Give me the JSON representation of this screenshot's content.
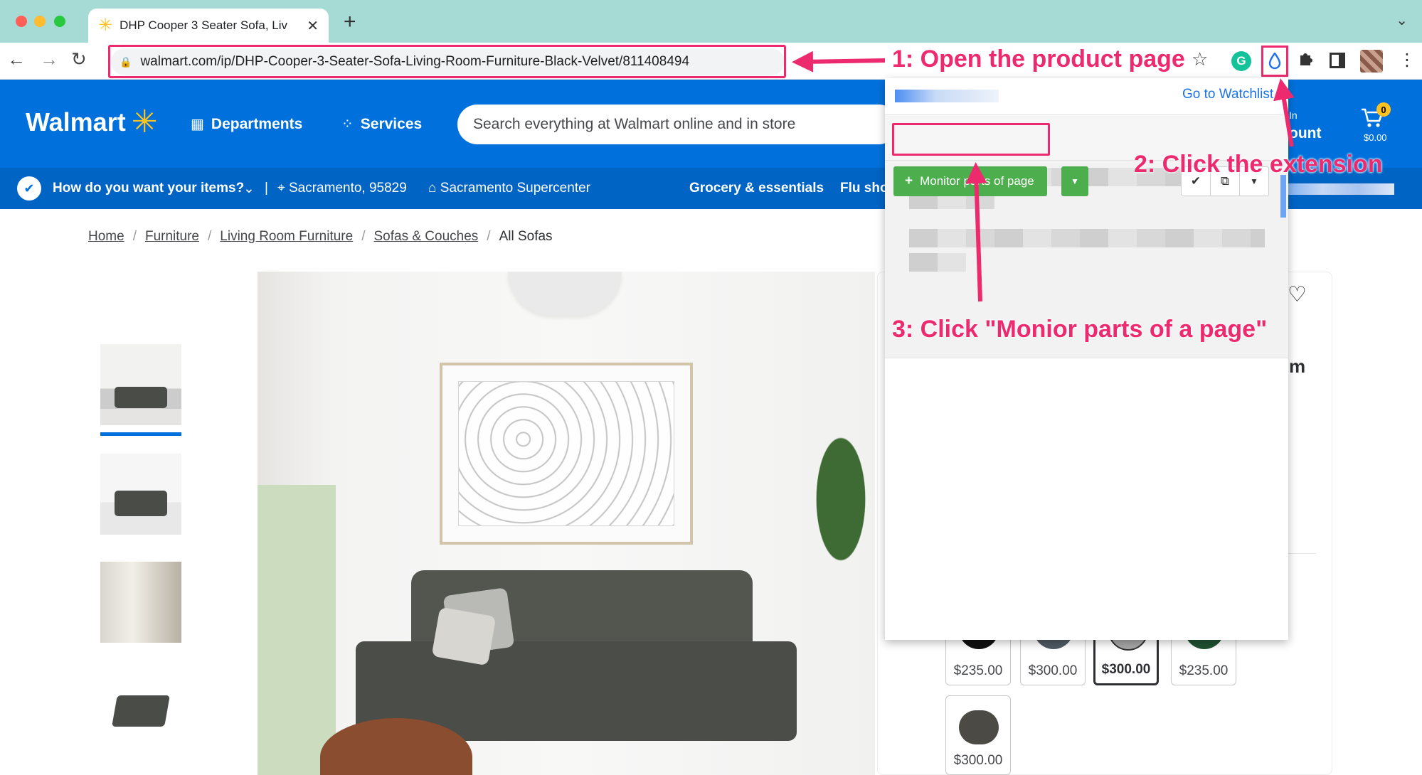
{
  "browser": {
    "tab": {
      "title": "DHP Cooper 3 Seater Sofa, Liv",
      "favicon": "walmart-spark-icon",
      "close": "✕"
    },
    "new_tab": "+",
    "url": "walmart.com/ip/DHP-Cooper-3-Seater-Sofa-Living-Room-Furniture-Black-Velvet/811408494",
    "nav": {
      "back": "←",
      "forward": "→",
      "reload": "↻"
    },
    "star": "☆",
    "grammarly": "G",
    "extension_icon": "💧",
    "puzzle": "✚",
    "kebab": "⋮"
  },
  "walmart": {
    "logo_text": "Walmart",
    "spark": "✳",
    "departments": "Departments",
    "services": "Services",
    "search_placeholder": "Search everything at Walmart online and in store",
    "account_partial": "ount",
    "signin_partial": "In",
    "cart_count": "0",
    "cart_total": "$0.00",
    "subbar": {
      "how": "How do you want your items?",
      "chevron": "⌄",
      "separator": "|",
      "location": "Sacramento, 95829",
      "store": "Sacramento Supercenter",
      "grocery": "Grocery & essentials",
      "flu": "Flu sho"
    }
  },
  "breadcrumb": {
    "items": [
      "Home",
      "Furniture",
      "Living Room Furniture",
      "Sofas & Couches"
    ],
    "current": "All Sofas",
    "separator": "/"
  },
  "product": {
    "heart": "♡",
    "partial_letter": "m",
    "swatches": [
      {
        "price": "$235.00",
        "color": "#111111",
        "selected": false
      },
      {
        "price": "$300.00",
        "color": "#505a63",
        "selected": false
      },
      {
        "price": "$300.00",
        "color": "#a8a8a8",
        "selected": true
      },
      {
        "price": "$235.00",
        "color": "#1f5232",
        "selected": false
      },
      {
        "price": "$300.00",
        "color": "#4b4a45",
        "selected": false
      }
    ]
  },
  "popup": {
    "watchlist": "Go to Watchlist",
    "monitor_label": "Monitor parts of page",
    "monitor_plus": "+",
    "dropdown": "▼",
    "check": "✔",
    "open": "⧉",
    "caret": "▼"
  },
  "annotations": {
    "step1": "1: Open the product page",
    "step2": "2: Click the extension",
    "step3": "3: Click \"Monior parts of a page\""
  },
  "colors": {
    "walmart_blue": "#0071dc",
    "walmart_yellow": "#ffc220",
    "annotation_pink": "#ec2a6d",
    "monitor_green": "#4cae4c"
  }
}
